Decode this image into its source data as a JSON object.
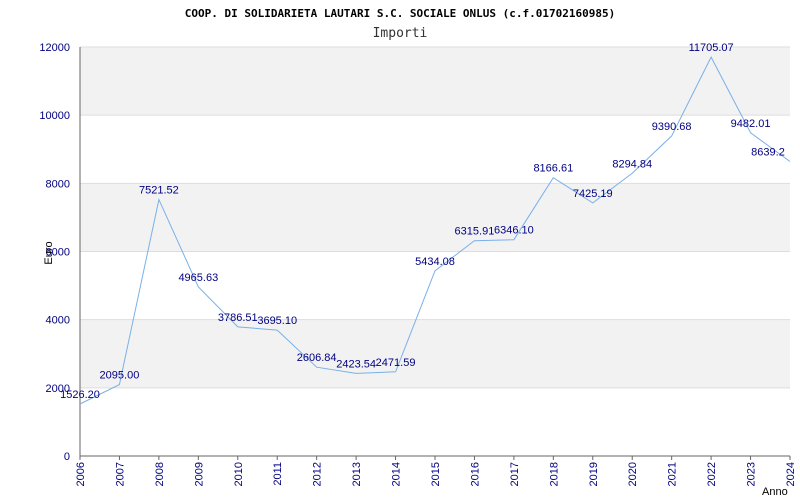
{
  "chart_data": {
    "type": "line",
    "title": "COOP. DI SOLIDARIETA LAUTARI S.C. SOCIALE ONLUS (c.f.01702160985)",
    "subtitle": "Importi",
    "xlabel": "Anno",
    "ylabel": "Euro",
    "ylim": [
      0,
      12000
    ],
    "yticks": [
      "0",
      "2000",
      "4000",
      "6000",
      "8000",
      "10000",
      "12000"
    ],
    "categories": [
      "2006",
      "2007",
      "2008",
      "2009",
      "2010",
      "2011",
      "2012",
      "2013",
      "2014",
      "2015",
      "2016",
      "2017",
      "2018",
      "2019",
      "2020",
      "2021",
      "2022",
      "2023",
      "2024"
    ],
    "values": [
      1526.2,
      2095.0,
      7521.52,
      4965.63,
      3786.51,
      3695.1,
      2606.84,
      2423.54,
      2471.59,
      5434.08,
      6315.91,
      6346.1,
      8166.61,
      7425.19,
      8294.84,
      9390.68,
      11705.07,
      9482.01,
      8639.2
    ],
    "value_labels": [
      "1526.20",
      "2095.00",
      "7521.52",
      "4965.63",
      "3786.51",
      "3695.10",
      "2606.84",
      "2423.54",
      "2471.59",
      "5434.08",
      "6315.91",
      "6346.10",
      "8166.61",
      "7425.19",
      "8294.84",
      "9390.68",
      "11705.07",
      "9482.01",
      "8639.2"
    ],
    "grid": true,
    "colors": {
      "line": "#7ab0e8",
      "band": "#f2f2f2",
      "tick": "#000080",
      "axis": "#666666"
    }
  }
}
